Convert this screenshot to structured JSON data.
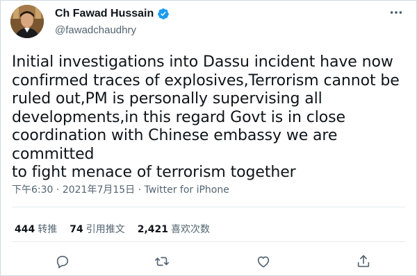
{
  "author": {
    "display_name": "Ch Fawad Hussain",
    "handle": "@fawadchaudhry",
    "verified": true
  },
  "more_icon": "more-icon",
  "tweet": {
    "lines": [
      "Initial investigations into Dassu incident have now",
      "confirmed traces of explosives,Terrorism cannot be",
      "ruled out,PM is personally supervising all",
      "developments,in this regard Govt is in close",
      "coordination with Chinese embassy we are committed",
      "to fight menace of terrorism together"
    ]
  },
  "meta": {
    "time": "下午6:30",
    "separator": " · ",
    "date": "2021年7月15日",
    "source": "Twitter for iPhone"
  },
  "stats": {
    "retweets_count": "444",
    "retweets_label": "转推",
    "quotes_count": "74",
    "quotes_label": "引用推文",
    "likes_count": "2,421",
    "likes_label": "喜欢次数"
  },
  "actions": [
    "reply-icon",
    "retweet-icon",
    "like-icon",
    "share-icon"
  ],
  "colors": {
    "verified_blue": "#1d9bf0",
    "secondary_text": "#536471",
    "primary_text": "#0f1419",
    "divider": "#e6ecf0"
  }
}
